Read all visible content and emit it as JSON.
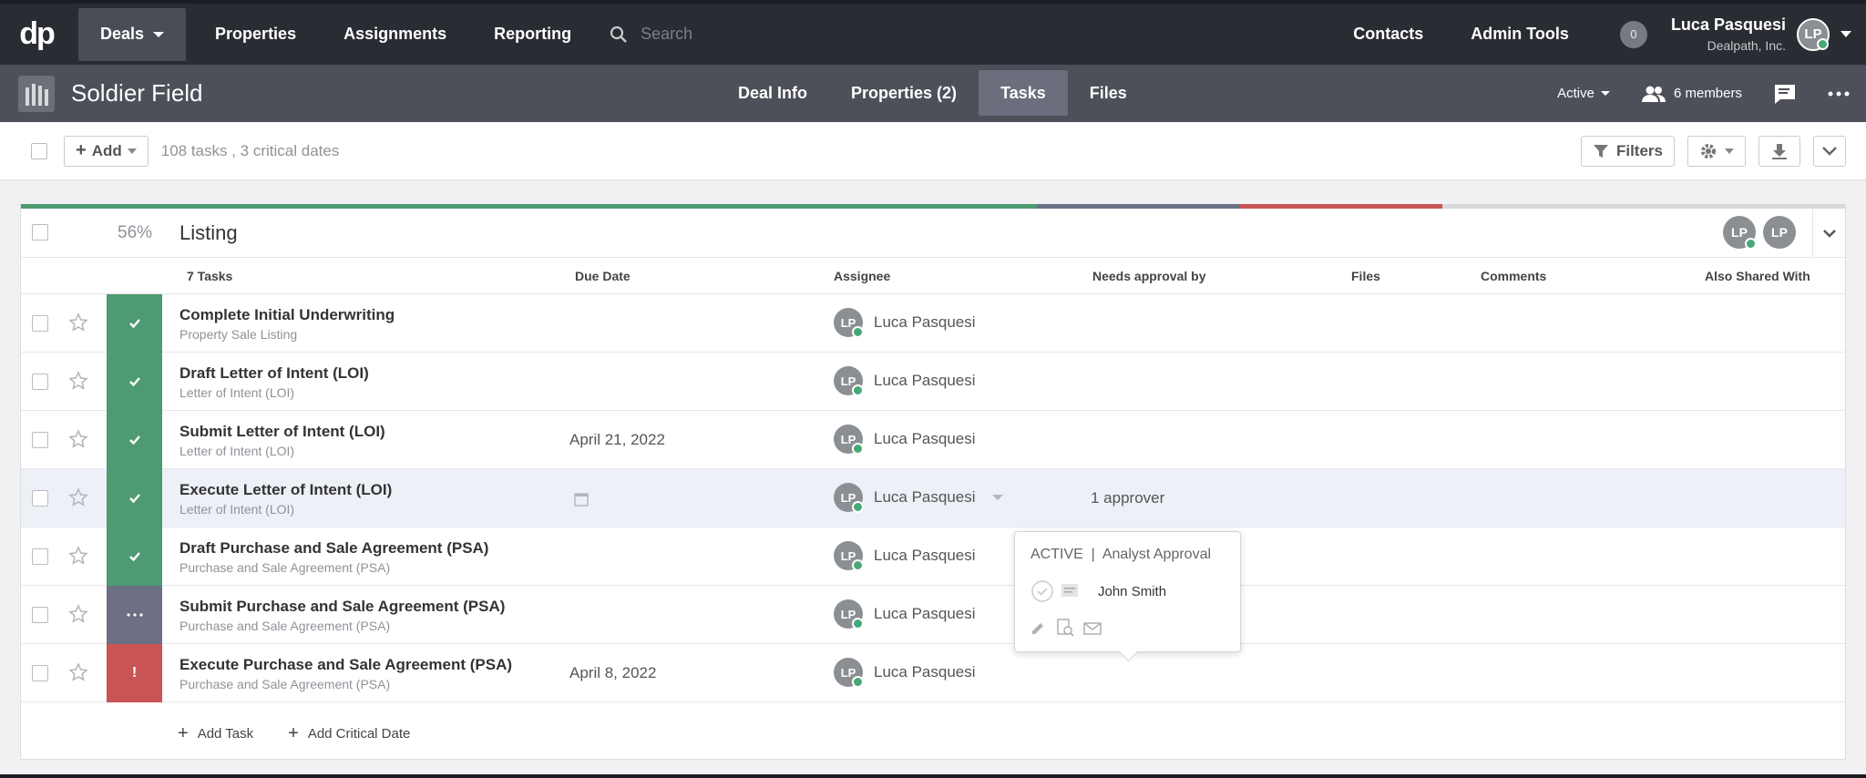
{
  "nav": {
    "logo": "dp",
    "items": [
      "Deals",
      "Properties",
      "Assignments",
      "Reporting"
    ],
    "search_placeholder": "Search",
    "right_items": [
      "Contacts",
      "Admin Tools"
    ],
    "notification_count": "0",
    "user_name": "Luca Pasquesi",
    "user_org": "Dealpath, Inc.",
    "user_initials": "LP"
  },
  "deal": {
    "title": "Soldier Field",
    "tabs": [
      "Deal Info",
      "Properties (2)",
      "Tasks",
      "Files"
    ],
    "active_tab": "Tasks",
    "status": "Active",
    "members": "6 members"
  },
  "toolbar": {
    "add_label": "Add",
    "summary": "108 tasks , 3 critical dates",
    "filters_label": "Filters"
  },
  "section": {
    "percent": "56%",
    "title": "Listing",
    "member_initials": [
      "LP",
      "LP"
    ],
    "progress_colors": [
      "#4e9a72",
      "#6d7084",
      "#c95454",
      "#d9d9dc"
    ],
    "progress_fractions": [
      0.557,
      0.111,
      0.111,
      0.221
    ],
    "columns": {
      "tasks": "7 Tasks",
      "due": "Due Date",
      "assignee": "Assignee",
      "approval": "Needs approval by",
      "files": "Files",
      "comments": "Comments",
      "shared": "Also Shared With"
    },
    "tasks": [
      {
        "name": "Complete Initial Underwriting",
        "sub": "Property Sale Listing",
        "due": "",
        "assignee": "Luca Pasquesi",
        "initials": "LP",
        "status": "done"
      },
      {
        "name": "Draft Letter of Intent (LOI)",
        "sub": "Letter of Intent (LOI)",
        "due": "",
        "assignee": "Luca Pasquesi",
        "initials": "LP",
        "status": "done"
      },
      {
        "name": "Submit Letter of Intent (LOI)",
        "sub": "Letter of Intent (LOI)",
        "due": "April 21, 2022",
        "assignee": "Luca Pasquesi",
        "initials": "LP",
        "status": "done"
      },
      {
        "name": "Execute Letter of Intent (LOI)",
        "sub": "Letter of Intent (LOI)",
        "due": "",
        "assignee": "Luca Pasquesi",
        "initials": "LP",
        "status": "done",
        "approval": "1 approver"
      },
      {
        "name": "Draft Purchase and Sale Agreement (PSA)",
        "sub": "Purchase and Sale Agreement (PSA)",
        "due": "",
        "assignee": "Luca Pasquesi",
        "initials": "LP",
        "status": "done"
      },
      {
        "name": "Submit Purchase and Sale Agreement (PSA)",
        "sub": "Purchase and Sale Agreement (PSA)",
        "due": "",
        "assignee": "Luca Pasquesi",
        "initials": "LP",
        "status": "in-progress"
      },
      {
        "name": "Execute Purchase and Sale Agreement (PSA)",
        "sub": "Purchase and Sale Agreement (PSA)",
        "due": "April 8, 2022",
        "assignee": "Luca Pasquesi",
        "initials": "LP",
        "status": "overdue"
      }
    ],
    "add_task": "Add Task",
    "add_critical_date": "Add Critical Date"
  },
  "popover": {
    "status_label": "ACTIVE  |  Analyst Approval",
    "approver": "John Smith"
  },
  "colors": {
    "done": "#4e9a72",
    "in_progress": "#6d7084",
    "overdue": "#c95454"
  }
}
